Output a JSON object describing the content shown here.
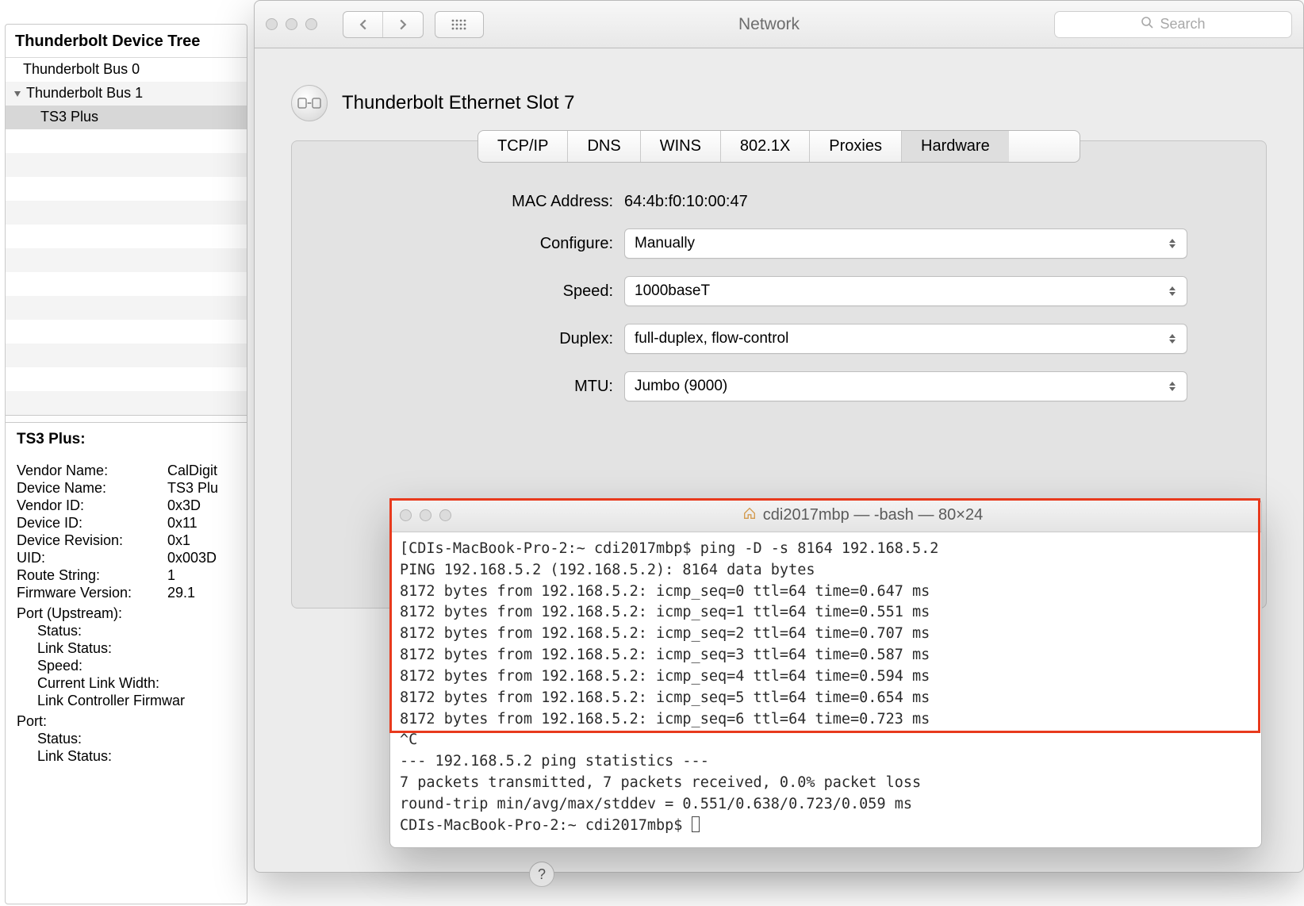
{
  "sysinfo": {
    "header": "Thunderbolt Device Tree",
    "tree": [
      {
        "label": "Thunderbolt Bus 0",
        "expandable": false,
        "indent": 0
      },
      {
        "label": "Thunderbolt Bus 1",
        "expandable": true,
        "expanded": true,
        "indent": 0
      },
      {
        "label": "TS3 Plus",
        "expandable": false,
        "indent": 1,
        "selected": true
      }
    ],
    "details_title": "TS3 Plus:",
    "details": {
      "vendor_name_label": "Vendor Name:",
      "vendor_name": "CalDigit",
      "device_name_label": "Device Name:",
      "device_name": "TS3 Plu",
      "vendor_id_label": "Vendor ID:",
      "vendor_id": "0x3D",
      "device_id_label": "Device ID:",
      "device_id": "0x11",
      "device_rev_label": "Device Revision:",
      "device_rev": "0x1",
      "uid_label": "UID:",
      "uid": "0x003D",
      "route_label": "Route String:",
      "route": "1",
      "fw_label": "Firmware Version:",
      "fw": "29.1",
      "port_up_label": "Port (Upstream):",
      "status_label": "Status:",
      "link_status_label": "Link Status:",
      "speed_label": "Speed:",
      "clw_label": "Current Link Width:",
      "lcfw_label": "Link Controller Firmwar",
      "port_label": "Port:"
    }
  },
  "prefwin": {
    "title": "Network",
    "search_placeholder": "Search",
    "iface_title": "Thunderbolt Ethernet Slot 7",
    "tabs": [
      "TCP/IP",
      "DNS",
      "WINS",
      "802.1X",
      "Proxies",
      "Hardware"
    ],
    "active_tab": "Hardware",
    "form": {
      "mac_label": "MAC Address:",
      "mac_value": "64:4b:f0:10:00:47",
      "configure_label": "Configure:",
      "configure_value": "Manually",
      "speed_label": "Speed:",
      "speed_value": "1000baseT",
      "duplex_label": "Duplex:",
      "duplex_value": "full-duplex, flow-control",
      "mtu_label": "MTU:",
      "mtu_value": "Jumbo  (9000)"
    }
  },
  "terminal": {
    "title": "cdi2017mbp — -bash — 80×24",
    "lines": [
      "[CDIs-MacBook-Pro-2:~ cdi2017mbp$ ping -D -s 8164 192.168.5.2",
      "PING 192.168.5.2 (192.168.5.2): 8164 data bytes",
      "8172 bytes from 192.168.5.2: icmp_seq=0 ttl=64 time=0.647 ms",
      "8172 bytes from 192.168.5.2: icmp_seq=1 ttl=64 time=0.551 ms",
      "8172 bytes from 192.168.5.2: icmp_seq=2 ttl=64 time=0.707 ms",
      "8172 bytes from 192.168.5.2: icmp_seq=3 ttl=64 time=0.587 ms",
      "8172 bytes from 192.168.5.2: icmp_seq=4 ttl=64 time=0.594 ms",
      "8172 bytes from 192.168.5.2: icmp_seq=5 ttl=64 time=0.654 ms",
      "8172 bytes from 192.168.5.2: icmp_seq=6 ttl=64 time=0.723 ms",
      "^C",
      "--- 192.168.5.2 ping statistics ---",
      "7 packets transmitted, 7 packets received, 0.0% packet loss",
      "round-trip min/avg/max/stddev = 0.551/0.638/0.723/0.059 ms",
      "CDIs-MacBook-Pro-2:~ cdi2017mbp$ "
    ],
    "highlight_rows": {
      "from": 0,
      "to": 9
    }
  }
}
